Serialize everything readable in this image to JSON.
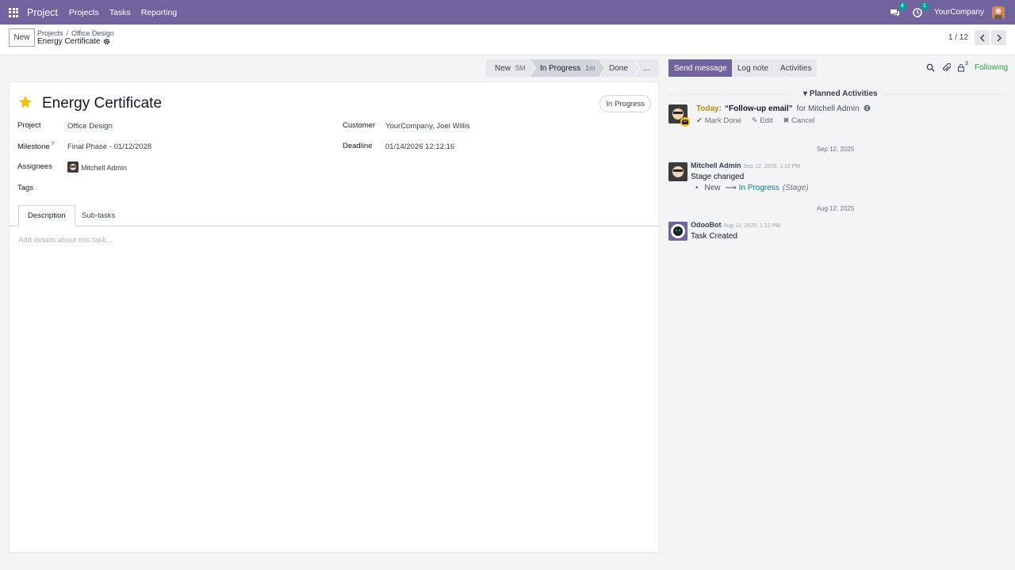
{
  "nav": {
    "brand": "Project",
    "menu": [
      "Projects",
      "Tasks",
      "Reporting"
    ],
    "messages_count": "4",
    "activities_count": "1",
    "company": "YourCompany"
  },
  "control": {
    "new_label": "New",
    "breadcrumb": [
      "Projects",
      "Office Design"
    ],
    "record": "Energy Certificate",
    "pager": "1 / 12"
  },
  "statusbar": {
    "stages": [
      {
        "label": "New",
        "duration": "5M"
      },
      {
        "label": "In Progress",
        "duration": "1m"
      },
      {
        "label": "Done",
        "duration": ""
      },
      {
        "label": "...",
        "duration": ""
      }
    ]
  },
  "form": {
    "title": "Energy Certificate",
    "state": "In Progress",
    "project_label": "Project",
    "project_value": "Office Design",
    "milestone_label": "Milestone",
    "milestone_help": "?",
    "milestone_value": "Final Phase - 01/12/2028",
    "assignees_label": "Assignees",
    "assignee_value": "Mitchell Admin",
    "tags_label": "Tags",
    "customer_label": "Customer",
    "customer_value": "YourCompany, Joel Willis",
    "deadline_label": "Deadline",
    "deadline_value": "01/14/2026 12:12:16",
    "tabs": [
      "Description",
      "Sub-tasks"
    ],
    "description_placeholder": "Add details about this task..."
  },
  "chatter": {
    "send_message": "Send message",
    "log_note": "Log note",
    "activities": "Activities",
    "followers_count": "3",
    "following": "Following",
    "planned_title": "Planned Activities",
    "activity": {
      "today": "Today:",
      "summary": "“Follow-up email”",
      "for_text": "for Mitchell Admin",
      "mark_done": "Mark Done",
      "edit": "Edit",
      "cancel": "Cancel"
    },
    "messages": [
      {
        "date_sep": "Sep 12, 2025",
        "author": "Mitchell Admin",
        "date": "Sep 12, 2025, 1:12 PM",
        "body": "Stage changed",
        "old_value": "New",
        "new_value": "In Progress",
        "field": "(Stage)"
      },
      {
        "date_sep": "Aug 12, 2025",
        "author": "OdooBot",
        "date": "Aug 12, 2025, 1:12 PM",
        "body": "Task Created"
      }
    ]
  },
  "colors": {
    "brand": "#71639e",
    "following": "#28a745",
    "badge": "#00a09d",
    "star": "#f3c200"
  }
}
